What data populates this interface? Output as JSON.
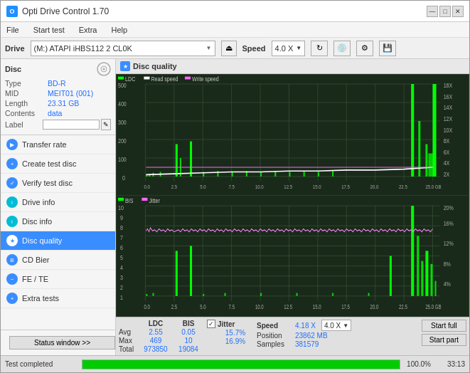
{
  "app": {
    "title": "Opti Drive Control 1.70",
    "icon": "O"
  },
  "titlebar": {
    "minimize": "—",
    "maximize": "□",
    "close": "✕"
  },
  "menubar": {
    "items": [
      "File",
      "Start test",
      "Extra",
      "Help"
    ]
  },
  "drivebar": {
    "drive_label": "Drive",
    "drive_value": "(M:) ATAPI iHBS112  2 CL0K",
    "speed_label": "Speed",
    "speed_value": "4.0 X"
  },
  "disc": {
    "title": "Disc",
    "type_label": "Type",
    "type_value": "BD-R",
    "mid_label": "MID",
    "mid_value": "MEIT01 (001)",
    "length_label": "Length",
    "length_value": "23.31 GB",
    "contents_label": "Contents",
    "contents_value": "data",
    "label_label": "Label",
    "label_value": ""
  },
  "nav": {
    "items": [
      {
        "id": "transfer-rate",
        "label": "Transfer rate",
        "active": false
      },
      {
        "id": "create-test-disc",
        "label": "Create test disc",
        "active": false
      },
      {
        "id": "verify-test-disc",
        "label": "Verify test disc",
        "active": false
      },
      {
        "id": "drive-info",
        "label": "Drive info",
        "active": false
      },
      {
        "id": "disc-info",
        "label": "Disc info",
        "active": false
      },
      {
        "id": "disc-quality",
        "label": "Disc quality",
        "active": true
      },
      {
        "id": "cd-bier",
        "label": "CD Bier",
        "active": false
      },
      {
        "id": "fe-te",
        "label": "FE / TE",
        "active": false
      },
      {
        "id": "extra-tests",
        "label": "Extra tests",
        "active": false
      }
    ]
  },
  "status_window_btn": "Status window >>",
  "disc_quality": {
    "title": "Disc quality",
    "chart1": {
      "legend": [
        {
          "label": "LDC",
          "color": "#00ff00"
        },
        {
          "label": "Read speed",
          "color": "#ffffff"
        },
        {
          "label": "Write speed",
          "color": "#ff66ff"
        }
      ],
      "y_max": 500,
      "y_right_labels": [
        "18X",
        "16X",
        "14X",
        "12X",
        "10X",
        "8X",
        "6X",
        "4X",
        "2X"
      ],
      "x_labels": [
        "0.0",
        "2.5",
        "5.0",
        "7.5",
        "10.0",
        "12.5",
        "15.0",
        "17.5",
        "20.0",
        "22.5",
        "25.0 GB"
      ]
    },
    "chart2": {
      "legend": [
        {
          "label": "BIS",
          "color": "#00ff00"
        },
        {
          "label": "Jitter",
          "color": "#ff66ff"
        }
      ],
      "y_max": 10,
      "y_right_max": "20%",
      "x_labels": [
        "0.0",
        "2.5",
        "5.0",
        "7.5",
        "10.0",
        "12.5",
        "15.0",
        "17.5",
        "20.0",
        "22.5",
        "25.0 GB"
      ]
    },
    "stats": {
      "ldc_label": "LDC",
      "bis_label": "BIS",
      "jitter_label": "Jitter",
      "speed_label": "Speed",
      "position_label": "Position",
      "samples_label": "Samples",
      "avg_label": "Avg",
      "max_label": "Max",
      "total_label": "Total",
      "ldc_avg": "2.55",
      "ldc_max": "469",
      "ldc_total": "973850",
      "bis_avg": "0.05",
      "bis_max": "10",
      "bis_total": "19084",
      "jitter_avg": "15.7%",
      "jitter_max": "16.9%",
      "jitter_total": "",
      "speed_val": "4.18 X",
      "speed_select": "4.0 X",
      "position_val": "23862 MB",
      "samples_val": "381579"
    },
    "start_full_btn": "Start full",
    "start_part_btn": "Start part"
  },
  "bottom": {
    "status_text": "Test completed",
    "progress_pct": "100.0%",
    "progress_fill": 100,
    "time": "33:13"
  }
}
